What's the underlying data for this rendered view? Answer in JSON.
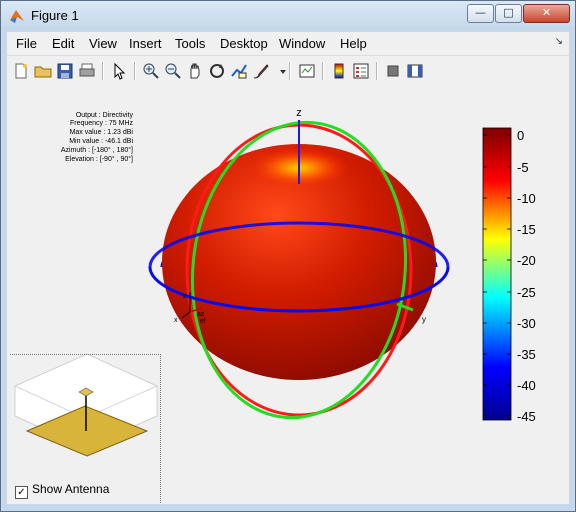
{
  "window": {
    "title": "Figure 1",
    "controls": {
      "minimize": "—",
      "maximize": "□",
      "close": "✕"
    }
  },
  "menu": [
    "File",
    "Edit",
    "View",
    "Insert",
    "Tools",
    "Desktop",
    "Window",
    "Help"
  ],
  "menu_corner": "↘",
  "toolbar": {
    "icons": [
      "new-figure-icon",
      "open-folder-icon",
      "save-icon",
      "print-icon",
      "pointer-icon",
      "zoom-in-icon",
      "zoom-out-icon",
      "pan-hand-icon",
      "rotate-3d-icon",
      "data-cursor-icon",
      "brush-icon",
      "brush-dropdown-icon",
      "link-plot-icon",
      "colorbar-icon",
      "legend-icon",
      "hide-plot-tools-icon",
      "show-plot-tools-icon"
    ]
  },
  "info": {
    "lines": [
      "Output : Directivity",
      "Frequency : 75 MHz",
      "Max value : 1.23 dBi",
      "Min value : -46.1 dBi",
      "Azimuth : [-180° , 180°]",
      "Elevation : [-90° , 90°]"
    ]
  },
  "axes": {
    "z_label": "z",
    "x_label": "x",
    "y_label": "y",
    "small_x": "x",
    "small_y": "y",
    "small_z": "z",
    "az_label": "az",
    "el_label": "el"
  },
  "colorbar": {
    "ticks": [
      "0",
      "-5",
      "-10",
      "-15",
      "-20",
      "-25",
      "-30",
      "-35",
      "-40",
      "-45"
    ],
    "colors": [
      "#7f0000",
      "#ff0000",
      "#ffff00",
      "#00ffff",
      "#0000ff",
      "#00008f"
    ]
  },
  "pattern_colors": {
    "sphere": "#cc1a00",
    "elevation_ring_red": "#ff1a1a",
    "elevation_ring_green": "#22dd22",
    "azimuth_ring_blue": "#0a0aee"
  },
  "antenna": {
    "show_label": "Show Antenna",
    "checked": true,
    "check_mark": "✓",
    "ground_color": "#d9b43a"
  }
}
